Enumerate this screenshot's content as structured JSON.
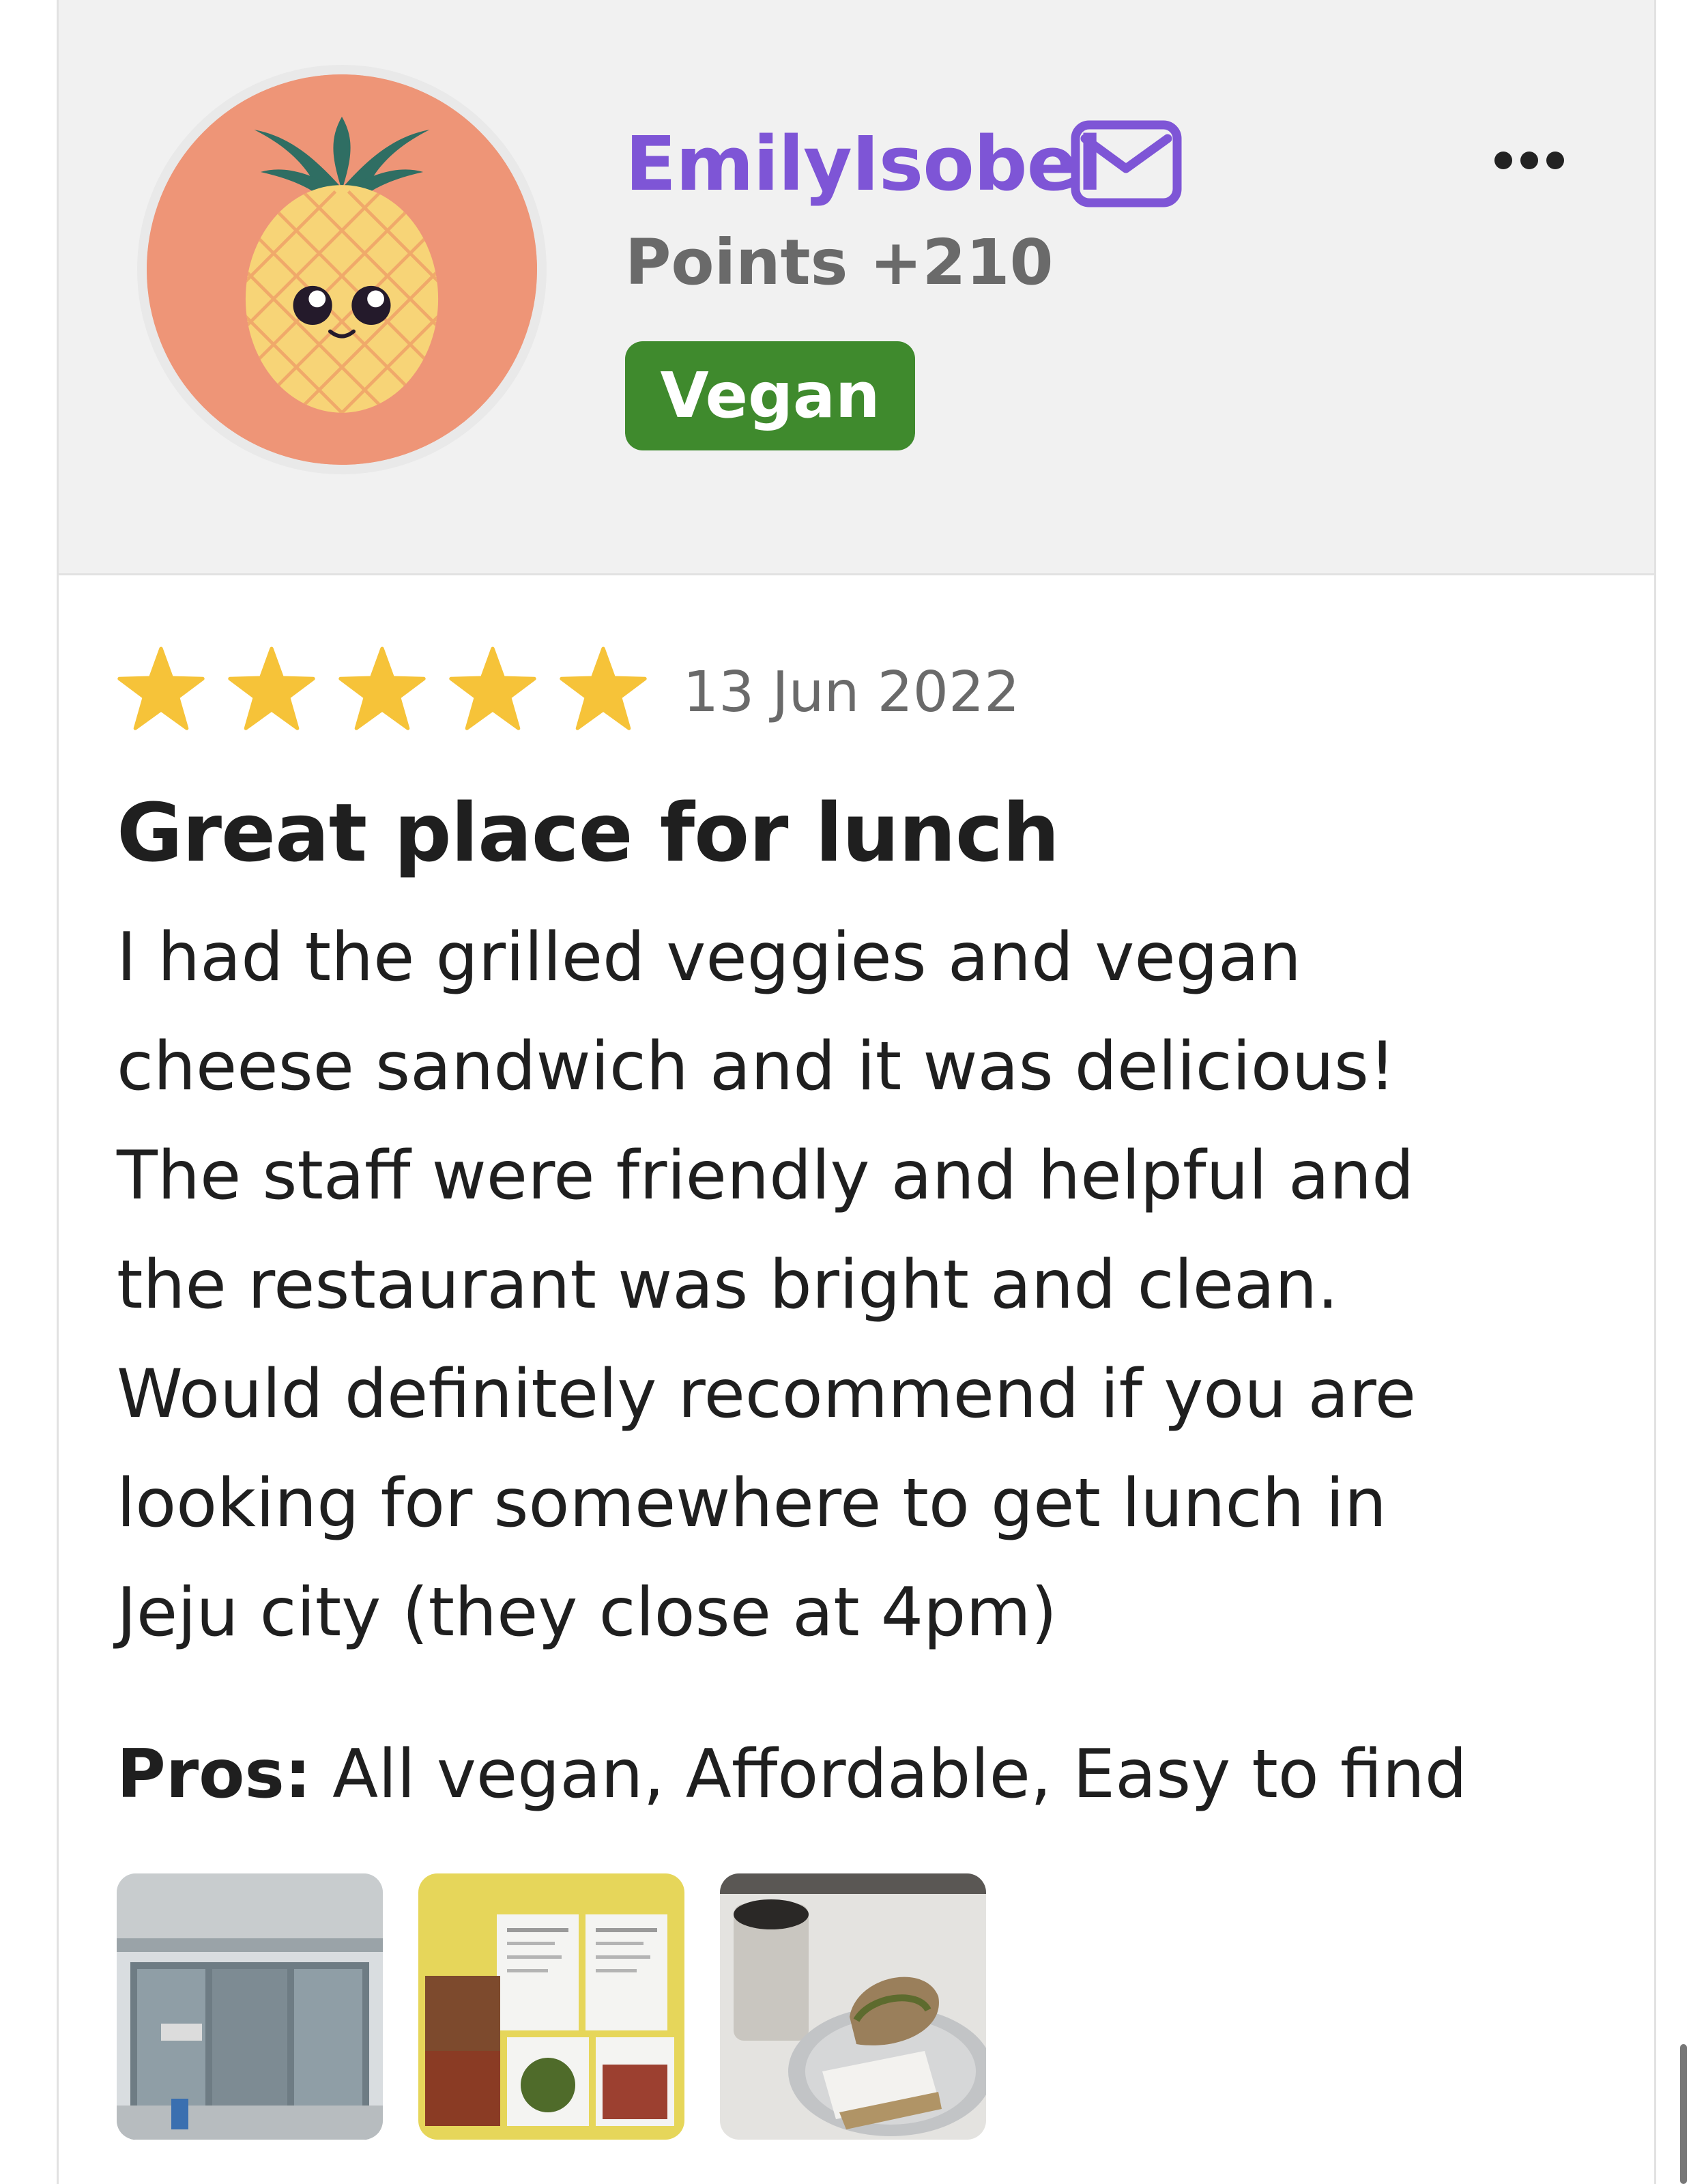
{
  "user": {
    "name": "EmilyIsobel",
    "points_label": "Points +210",
    "badge": "Vegan",
    "avatar_icon": "pineapple-avatar",
    "mail_icon": "mail-icon",
    "more_icon": "more-options-icon"
  },
  "review": {
    "rating": 5,
    "max_rating": 5,
    "date": "13 Jun 2022",
    "title": "Great place for lunch",
    "body_lines": [
      "I had the grilled veggies and vegan",
      "cheese sandwich and it was delicious!",
      "The staff were friendly and helpful and",
      "the restaurant was bright and clean.",
      "Would definitely recommend if you are",
      "looking for somewhere to get lunch in",
      "Jeju city (they close at 4pm)"
    ],
    "pros_label": "Pros:",
    "pros_value": "All vegan, Affordable, Easy to find"
  },
  "photos": [
    "restaurant-storefront-photo",
    "menu-photo",
    "sandwich-and-drink-photo"
  ],
  "colors": {
    "username": "#7e55d6",
    "badge": "#3f8a2d",
    "star": "#f6c339",
    "header_bg": "#f1f1f1",
    "avatar_bg": "#ee9577"
  }
}
